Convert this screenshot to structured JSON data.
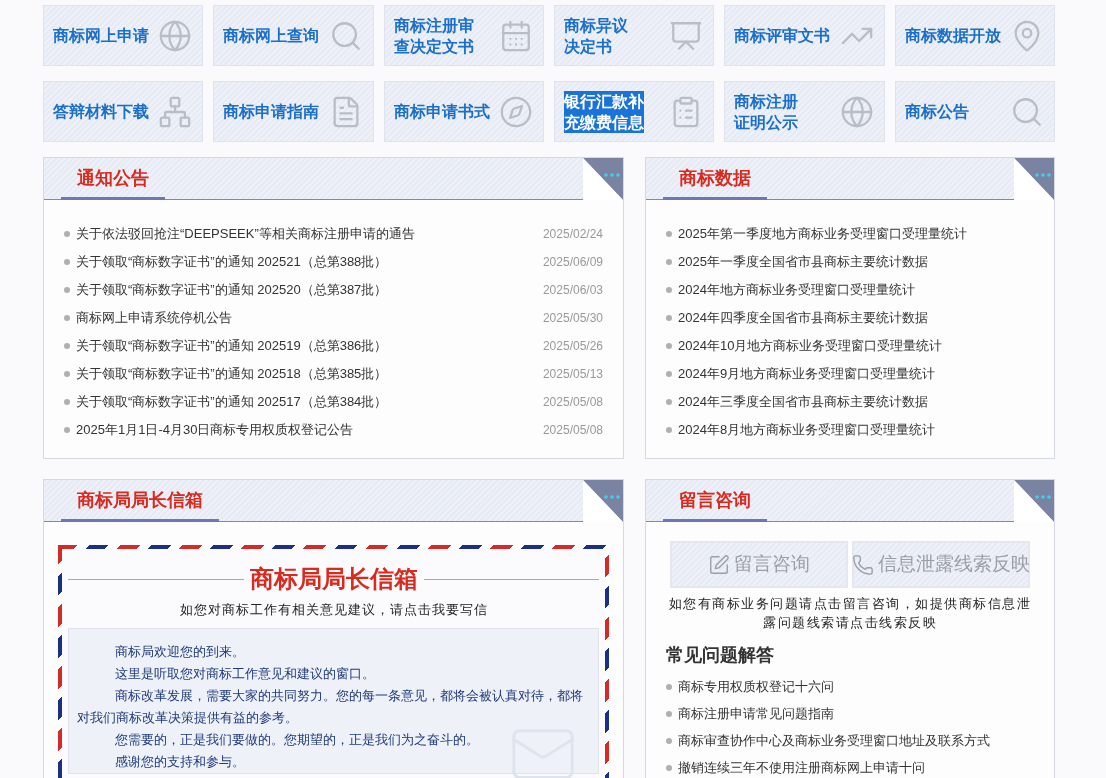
{
  "tiles": [
    {
      "lines": [
        "商标网上申请"
      ],
      "highlighted": false
    },
    {
      "lines": [
        "商标网上查询"
      ],
      "highlighted": false
    },
    {
      "lines": [
        "商标注册审",
        "查决定文书"
      ],
      "highlighted": false
    },
    {
      "lines": [
        "商标异议",
        "决定书"
      ],
      "highlighted": false
    },
    {
      "lines": [
        "商标评审文书"
      ],
      "highlighted": false
    },
    {
      "lines": [
        "商标数据开放"
      ],
      "highlighted": false
    },
    {
      "lines": [
        "答辩材料下载"
      ],
      "highlighted": false
    },
    {
      "lines": [
        "商标申请指南"
      ],
      "highlighted": false
    },
    {
      "lines": [
        "商标申请书式"
      ],
      "highlighted": false
    },
    {
      "lines": [
        "银行汇款补",
        "充缴费信息"
      ],
      "highlighted": true
    },
    {
      "lines": [
        "商标注册",
        "证明公示"
      ],
      "highlighted": false
    },
    {
      "lines": [
        "商标公告"
      ],
      "highlighted": false
    }
  ],
  "notices": {
    "title": "通知公告",
    "items": [
      {
        "text": "关于依法驳回抢注“DEEPSEEK”等相关商标注册申请的通告",
        "date": "2025/02/24"
      },
      {
        "text": "关于领取“商标数字证书”的通知 202521（总第388批）",
        "date": "2025/06/09"
      },
      {
        "text": "关于领取“商标数字证书”的通知 202520（总第387批）",
        "date": "2025/06/03"
      },
      {
        "text": "商标网上申请系统停机公告",
        "date": "2025/05/30"
      },
      {
        "text": "关于领取“商标数字证书”的通知 202519（总第386批）",
        "date": "2025/05/26"
      },
      {
        "text": "关于领取“商标数字证书”的通知 202518（总第385批）",
        "date": "2025/05/13"
      },
      {
        "text": "关于领取“商标数字证书”的通知 202517（总第384批）",
        "date": "2025/05/08"
      },
      {
        "text": "2025年1月1日-4月30日商标专用权质权登记公告",
        "date": "2025/05/08"
      }
    ]
  },
  "statistics": {
    "title": "商标数据",
    "items": [
      "2025年第一季度地方商标业务受理窗口受理量统计",
      "2025年一季度全国省市县商标主要统计数据",
      "2024年地方商标业务受理窗口受理量统计",
      "2024年四季度全国省市县商标主要统计数据",
      "2024年10月地方商标业务受理窗口受理量统计",
      "2024年9月地方商标业务受理窗口受理量统计",
      "2024年三季度全国省市县商标主要统计数据",
      "2024年8月地方商标业务受理窗口受理量统计"
    ]
  },
  "mailbox": {
    "title": "商标局局长信箱",
    "letter_title": "商标局局长信箱",
    "subtitle": "如您对商标工作有相关意见建议，请点击我要写信",
    "paragraphs": [
      "商标局欢迎您的到来。",
      "这里是听取您对商标工作意见和建议的窗口。",
      "商标改革发展，需要大家的共同努力。您的每一条意见，都将会被认真对待，都将对我们商标改革决策提供有益的参考。",
      "您需要的，正是我们要做的。您期望的，正是我们为之奋斗的。",
      "感谢您的支持和参与。"
    ]
  },
  "consult": {
    "title": "留言咨询",
    "buttons": [
      {
        "kind": "message",
        "label": "留言咨询"
      },
      {
        "kind": "phone",
        "label": "信息泄露线索反映"
      }
    ],
    "description": "如您有商标业务问题请点击留言咨询，如提供商标信息泄露问题线索请点击线索反映",
    "faq_title": "常见问题解答",
    "faq": [
      "商标专用权质权登记十六问",
      "商标注册申请常见问题指南",
      "商标审查协作中心及商标业务受理窗口地址及联系方式",
      "撤销连续三年不使用注册商标网上申请十问"
    ]
  }
}
